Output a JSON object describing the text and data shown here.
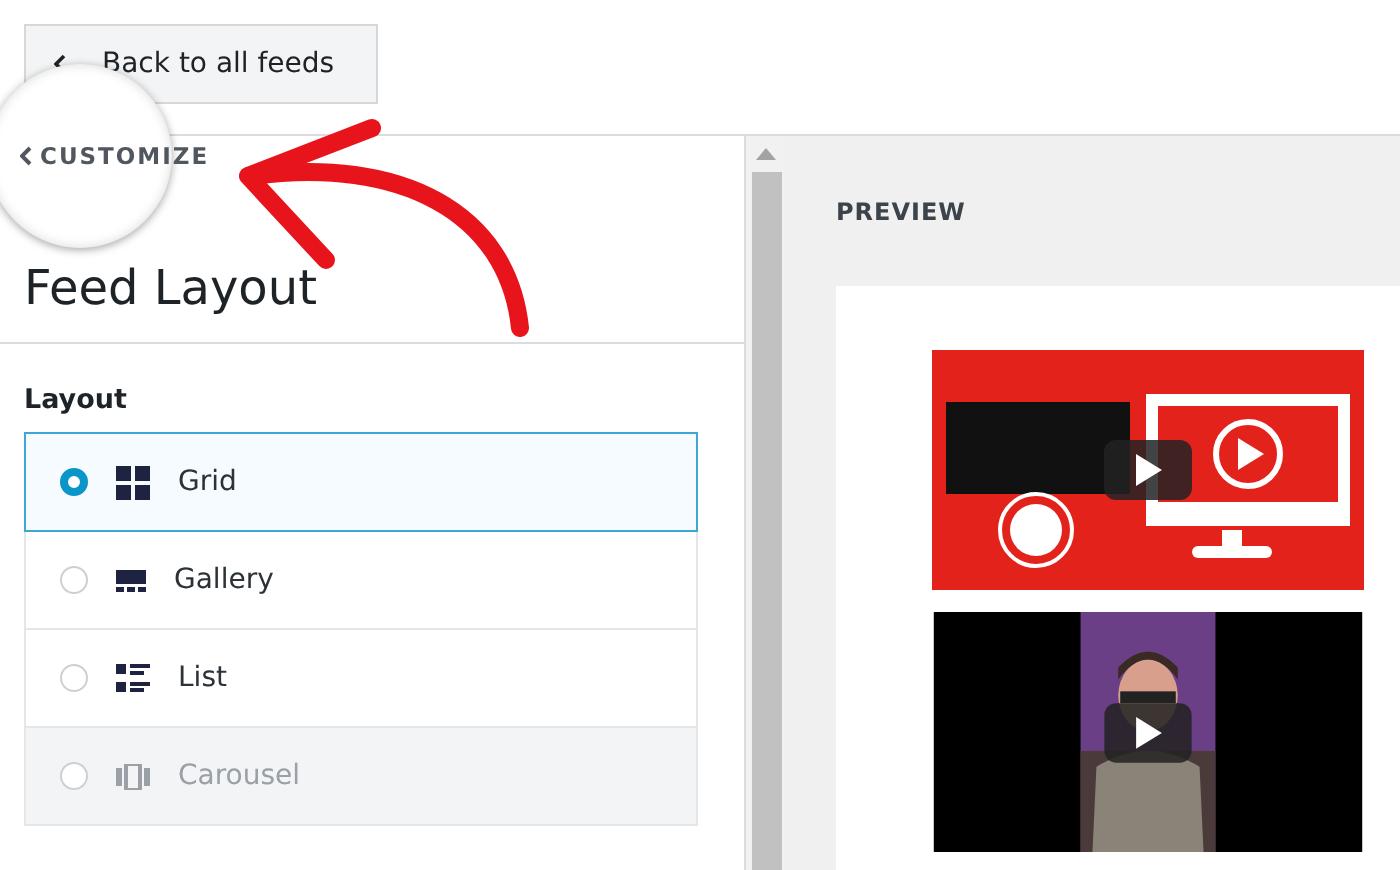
{
  "back_button": {
    "label": "Back to all feeds"
  },
  "magnifier": {
    "label": "CUSTOMIZE"
  },
  "panel": {
    "title": "Feed Layout",
    "section": "Layout",
    "options": [
      {
        "label": "Grid",
        "kind": "grid",
        "selected": true,
        "disabled": false
      },
      {
        "label": "Gallery",
        "kind": "gallery",
        "selected": false,
        "disabled": false
      },
      {
        "label": "List",
        "kind": "list",
        "selected": false,
        "disabled": false
      },
      {
        "label": "Carousel",
        "kind": "carousel",
        "selected": false,
        "disabled": true
      }
    ]
  },
  "preview": {
    "label": "PREVIEW"
  }
}
